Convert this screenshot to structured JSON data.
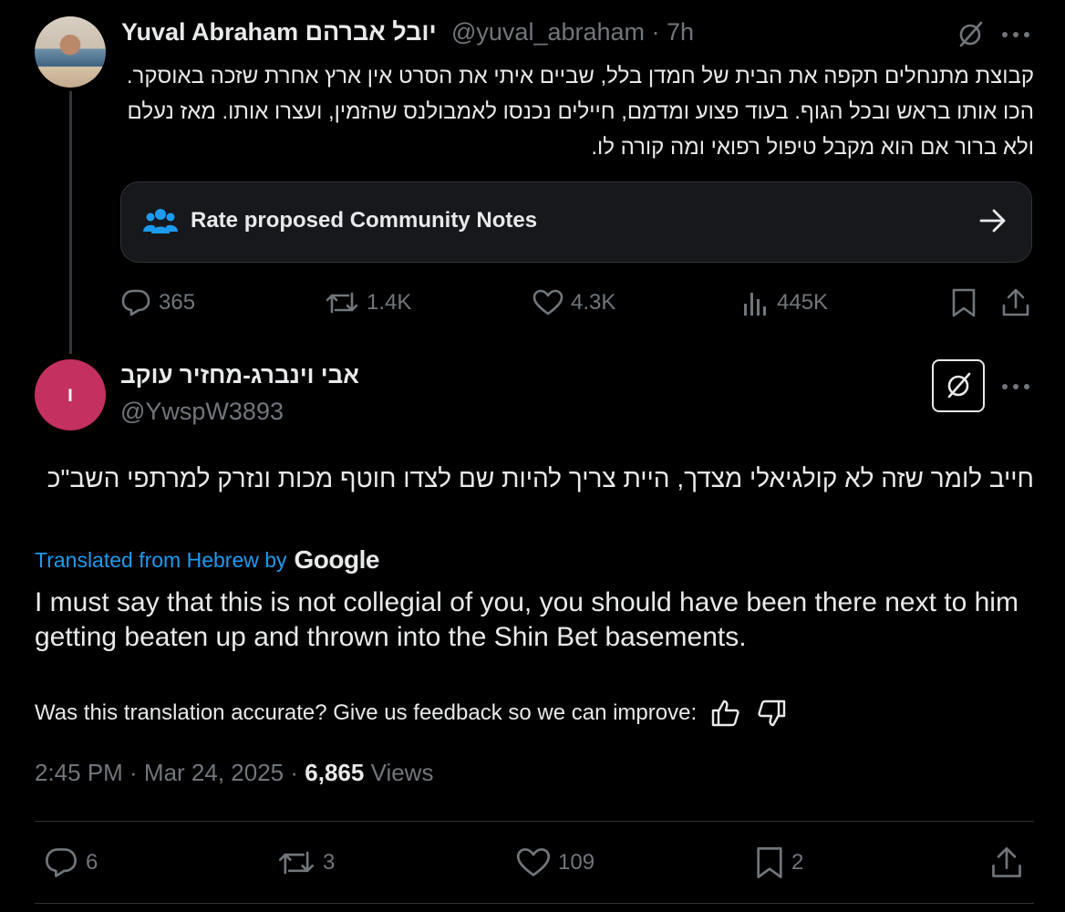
{
  "tweet": {
    "author_name": "Yuval Abraham יובל אברהם",
    "author_handle": "@yuval_abraham",
    "time_ago": "7h",
    "handle_time": "@yuval_abraham · 7h",
    "text": "קבוצת מתנחלים תקפה את הבית של חמדן בלל, שביים איתי את הסרט אין ארץ אחרת שזכה באוסקר. הכו אותו בראש ובכל הגוף. בעוד פצוע ומדמם, חיילים נכנסו לאמבולנס שהזמין, ועצרו אותו. מאז נעלם ולא ברור אם הוא מקבל טיפול רפואי ומה קורה לו.",
    "community_notes_label": "Rate proposed Community Notes",
    "stats": {
      "replies": "365",
      "reposts": "1.4K",
      "likes": "4.3K",
      "views": "445K"
    }
  },
  "reply": {
    "author_name": "אבי וינברג-מחזיר עוקב",
    "author_handle": "@YwspW3893",
    "avatar_initial": "ו",
    "text": "חייב לומר שזה לא קולגיאלי מצדך, היית צריך להיות שם לצדו חוטף מכות ונזרק למרתפי השב\"כ",
    "translated_label": "Translated from Hebrew by",
    "translated_provider": "Google",
    "translation": "I must say that this is not collegial of you, you should have been there next to him getting beaten up and thrown into the Shin Bet basements.",
    "feedback_prompt": "Was this translation accurate? Give us feedback so we can improve:",
    "timestamp": "2:45 PM · Mar 24, 2025 ·",
    "views_count": "6,865",
    "views_label": "Views",
    "stats": {
      "replies": "6",
      "reposts": "3",
      "likes": "109",
      "bookmarks": "2"
    }
  },
  "colors": {
    "background": "#000000",
    "text": "#e7e9ea",
    "muted": "#71767b",
    "link": "#1d9bf0",
    "avatar_reply": "#c4305f",
    "card": "#16181c",
    "border": "#2f3336"
  }
}
